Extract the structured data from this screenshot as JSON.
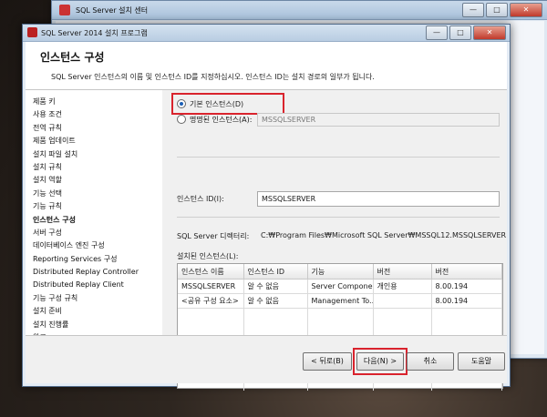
{
  "back_window": {
    "title": "SQL Server 설치 센터"
  },
  "dialog": {
    "title": "SQL Server 2014 설치 프로그램",
    "header_title": "인스턴스 구성",
    "header_desc": "SQL Server 인스턴스의 이름 및 인스턴스 ID를 지정하십시오. 인스턴스 ID는 설치 경로의 일부가 됩니다."
  },
  "sidebar": {
    "items": [
      {
        "label": "제품 키"
      },
      {
        "label": "사용 조건"
      },
      {
        "label": "전역 규칙"
      },
      {
        "label": "제품 업데이트"
      },
      {
        "label": "설치 파일 설치"
      },
      {
        "label": "설치 규칙"
      },
      {
        "label": "설치 역할"
      },
      {
        "label": "기능 선택"
      },
      {
        "label": "기능 규칙"
      },
      {
        "label": "인스턴스 구성"
      },
      {
        "label": "서버 구성"
      },
      {
        "label": "데이터베이스 엔진 구성"
      },
      {
        "label": "Reporting Services 구성"
      },
      {
        "label": "Distributed Replay Controller"
      },
      {
        "label": "Distributed Replay Client"
      },
      {
        "label": "기능 구성 규칙"
      },
      {
        "label": "설치 준비"
      },
      {
        "label": "설치 진행률"
      },
      {
        "label": "완료"
      }
    ],
    "active_index": 9
  },
  "instance": {
    "default_label": "기본 인스턴스(D)",
    "named_label": "명명된 인스턴스(A):",
    "named_value": "MSSQLSERVER",
    "id_label": "인스턴스 ID(I):",
    "id_value": "MSSQLSERVER",
    "dir_label": "SQL Server 디렉터리:",
    "dir_value": "C:₩Program Files₩Microsoft SQL Server₩MSSQL12.MSSQLSERVER",
    "installed_label": "설치된 인스턴스(L):"
  },
  "grid": {
    "headers": [
      "인스턴스 이름",
      "인스턴스 ID",
      "기능",
      "버전",
      "버전"
    ],
    "rows": [
      [
        "MSSQLSERVER",
        "알 수 없음",
        "Server Compone...",
        "개인용",
        "8.00.194"
      ],
      [
        "<공유 구성 요소>",
        "알 수 없음",
        "Management To...",
        "",
        "8.00.194"
      ]
    ]
  },
  "buttons": {
    "back": "< 뒤로(B)",
    "next": "다음(N) >",
    "cancel": "취소",
    "help": "도움말"
  },
  "window_controls": {
    "minimize": "—",
    "maximize": "□",
    "close": "✕"
  }
}
